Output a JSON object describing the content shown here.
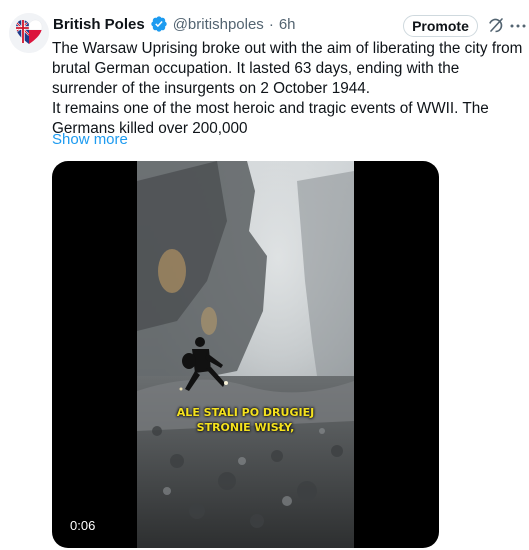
{
  "tweet": {
    "author": {
      "display_name": "British Poles",
      "handle": "@britishpoles",
      "separator": "·",
      "time": "6h",
      "verified": true
    },
    "promote_label": "Promote",
    "text_paragraphs": [
      "The Warsaw Uprising broke out with the aim of liberating the city from brutal German occupation. It lasted 63 days, ending with the surrender of the insurgents on 2 October 1944.",
      "It remains one of the most heroic and tragic events of WWII. The Germans killed over 200,000"
    ],
    "show_more_label": "Show more",
    "video": {
      "caption_lines": [
        "ALE STALI PO DRUGIEJ",
        "STRONIE WISŁY,"
      ],
      "timestamp": "0:06"
    }
  },
  "colors": {
    "accent": "#1d9bf0",
    "text_primary": "#0f1419",
    "text_secondary": "#536471",
    "caption": "#f5e21e"
  },
  "icons": {
    "avatar": "union-jack-poland-heart-avatar",
    "verified": "verified-badge-icon",
    "grok": "grok-icon",
    "more": "more-horizontal-icon"
  }
}
